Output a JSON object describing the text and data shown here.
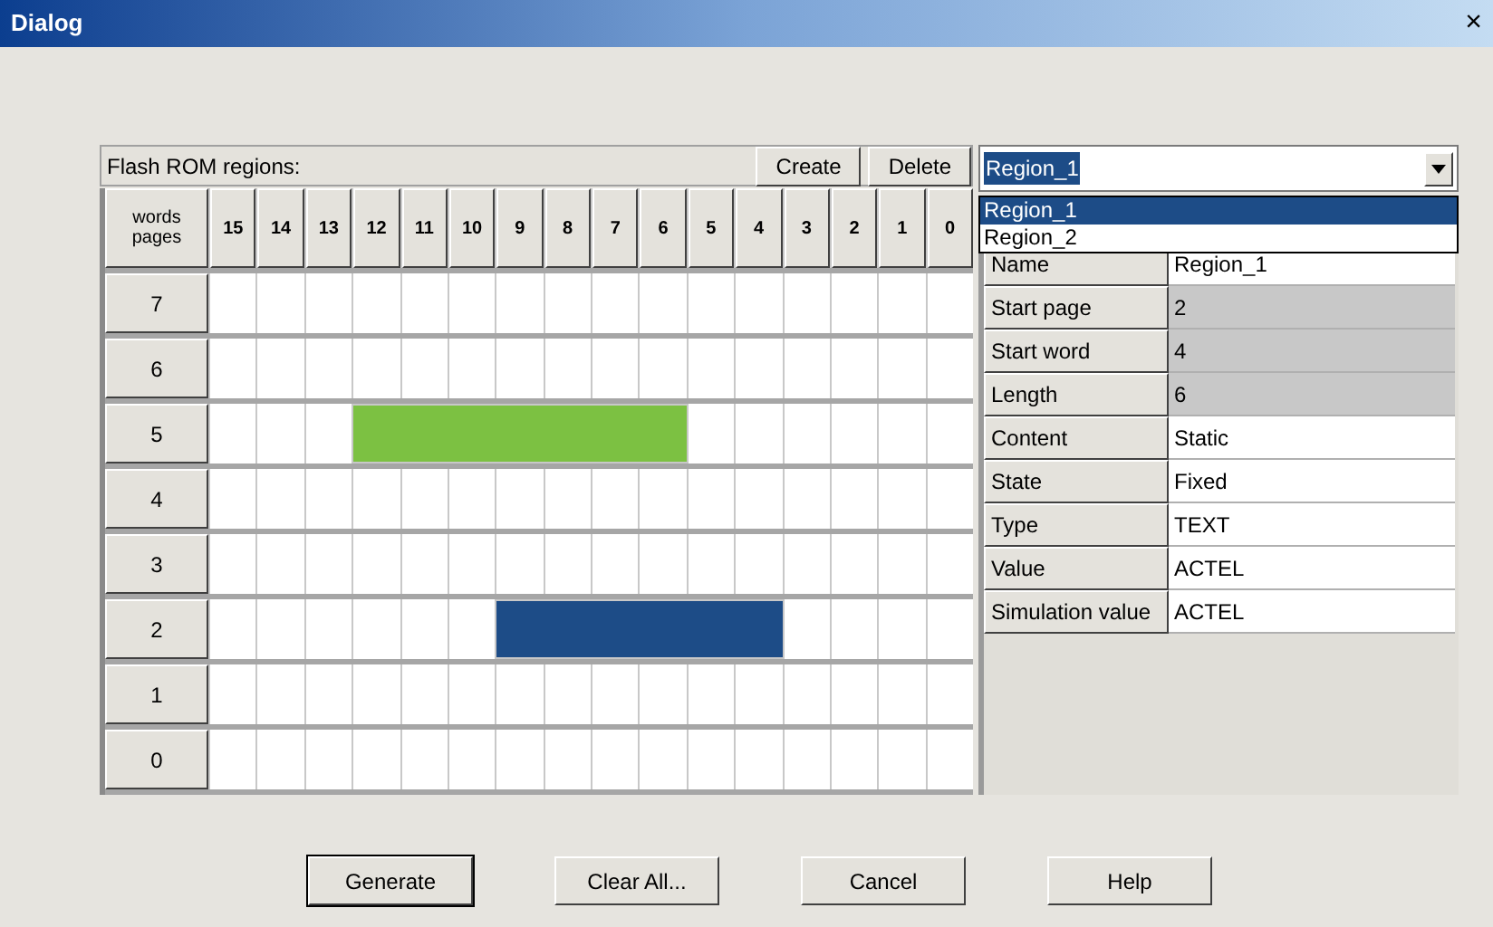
{
  "window": {
    "title": "Dialog",
    "close": "×"
  },
  "regions_panel": {
    "label": "Flash ROM regions:",
    "buttons": [
      "Create",
      "Delete"
    ]
  },
  "grid": {
    "corner": [
      "words",
      "pages"
    ],
    "columns": [
      "15",
      "14",
      "13",
      "12",
      "11",
      "10",
      "9",
      "8",
      "7",
      "6",
      "5",
      "4",
      "3",
      "2",
      "1",
      "0"
    ],
    "rows": [
      {
        "page": "7",
        "cells": [
          {
            "filled": false
          },
          {
            "filled": false
          },
          {
            "filled": false
          },
          {
            "filled": false
          },
          {
            "filled": false
          },
          {
            "filled": false
          },
          {
            "filled": false
          },
          {
            "filled": false
          },
          {
            "filled": false
          },
          {
            "filled": false
          },
          {
            "filled": false
          },
          {
            "filled": false
          },
          {
            "filled": false
          },
          {
            "filled": false
          },
          {
            "filled": false
          },
          {
            "filled": false
          }
        ]
      },
      {
        "page": "6",
        "cells": [
          {
            "filled": false
          },
          {
            "filled": false
          },
          {
            "filled": false
          },
          {
            "filled": false
          },
          {
            "filled": false
          },
          {
            "filled": false
          },
          {
            "filled": false
          },
          {
            "filled": false
          },
          {
            "filled": false
          },
          {
            "filled": false
          },
          {
            "filled": false
          },
          {
            "filled": false
          },
          {
            "filled": false
          },
          {
            "filled": false
          },
          {
            "filled": false
          },
          {
            "filled": false
          }
        ]
      },
      {
        "page": "5",
        "cells": [
          {
            "filled": false
          },
          {
            "filled": false
          },
          {
            "filled": false
          },
          {
            "filled": true,
            "color": "#7cc142"
          },
          {
            "filled": true,
            "color": "#7cc142"
          },
          {
            "filled": true,
            "color": "#7cc142"
          },
          {
            "filled": true,
            "color": "#7cc142"
          },
          {
            "filled": true,
            "color": "#7cc142"
          },
          {
            "filled": true,
            "color": "#7cc142"
          },
          {
            "filled": true,
            "color": "#7cc142"
          },
          {
            "filled": false
          },
          {
            "filled": false
          },
          {
            "filled": false
          },
          {
            "filled": false
          },
          {
            "filled": false
          },
          {
            "filled": false
          }
        ]
      },
      {
        "page": "4",
        "cells": [
          {
            "filled": false
          },
          {
            "filled": false
          },
          {
            "filled": false
          },
          {
            "filled": false
          },
          {
            "filled": false
          },
          {
            "filled": false
          },
          {
            "filled": false
          },
          {
            "filled": false
          },
          {
            "filled": false
          },
          {
            "filled": false
          },
          {
            "filled": false
          },
          {
            "filled": false
          },
          {
            "filled": false
          },
          {
            "filled": false
          },
          {
            "filled": false
          },
          {
            "filled": false
          }
        ]
      },
      {
        "page": "3",
        "cells": [
          {
            "filled": false
          },
          {
            "filled": false
          },
          {
            "filled": false
          },
          {
            "filled": false
          },
          {
            "filled": false
          },
          {
            "filled": false
          },
          {
            "filled": false
          },
          {
            "filled": false
          },
          {
            "filled": false
          },
          {
            "filled": false
          },
          {
            "filled": false
          },
          {
            "filled": false
          },
          {
            "filled": false
          },
          {
            "filled": false
          },
          {
            "filled": false
          },
          {
            "filled": false
          }
        ]
      },
      {
        "page": "2",
        "cells": [
          {
            "filled": false
          },
          {
            "filled": false
          },
          {
            "filled": false
          },
          {
            "filled": false
          },
          {
            "filled": false
          },
          {
            "filled": false
          },
          {
            "filled": true,
            "color": "#1d4c87"
          },
          {
            "filled": true,
            "color": "#1d4c87"
          },
          {
            "filled": true,
            "color": "#1d4c87"
          },
          {
            "filled": true,
            "color": "#1d4c87"
          },
          {
            "filled": true,
            "color": "#1d4c87"
          },
          {
            "filled": true,
            "color": "#1d4c87"
          },
          {
            "filled": false
          },
          {
            "filled": false
          },
          {
            "filled": false
          },
          {
            "filled": false
          }
        ]
      },
      {
        "page": "1",
        "cells": [
          {
            "filled": false
          },
          {
            "filled": false
          },
          {
            "filled": false
          },
          {
            "filled": false
          },
          {
            "filled": false
          },
          {
            "filled": false
          },
          {
            "filled": false
          },
          {
            "filled": false
          },
          {
            "filled": false
          },
          {
            "filled": false
          },
          {
            "filled": false
          },
          {
            "filled": false
          },
          {
            "filled": false
          },
          {
            "filled": false
          },
          {
            "filled": false
          },
          {
            "filled": false
          }
        ]
      },
      {
        "page": "0",
        "cells": [
          {
            "filled": false
          },
          {
            "filled": false
          },
          {
            "filled": false
          },
          {
            "filled": false
          },
          {
            "filled": false
          },
          {
            "filled": false
          },
          {
            "filled": false
          },
          {
            "filled": false
          },
          {
            "filled": false
          },
          {
            "filled": false
          },
          {
            "filled": false
          },
          {
            "filled": false
          },
          {
            "filled": false
          },
          {
            "filled": false
          },
          {
            "filled": false
          },
          {
            "filled": false
          }
        ]
      }
    ]
  },
  "region_select": {
    "value": "Region_1",
    "options": [
      {
        "label": "Region_1",
        "selected": true
      },
      {
        "label": "Region_2",
        "selected": false
      }
    ]
  },
  "properties": [
    {
      "label": "Name",
      "value": "Region_1",
      "disabled": false
    },
    {
      "label": "Start page",
      "value": "2",
      "disabled": true
    },
    {
      "label": "Start word",
      "value": "4",
      "disabled": true
    },
    {
      "label": "Length",
      "value": "6",
      "disabled": true
    },
    {
      "label": "Content",
      "value": "Static",
      "disabled": false
    },
    {
      "label": "State",
      "value": "Fixed",
      "disabled": false
    },
    {
      "label": "Type",
      "value": "TEXT",
      "disabled": false
    },
    {
      "label": "Value",
      "value": "ACTEL",
      "disabled": false
    },
    {
      "label": "Simulation value",
      "value": "ACTEL",
      "disabled": false
    }
  ],
  "buttons": [
    {
      "label": "Generate",
      "default": true
    },
    {
      "label": "Clear All...",
      "default": false
    },
    {
      "label": "Cancel",
      "default": false
    },
    {
      "label": "Help",
      "default": false
    }
  ]
}
